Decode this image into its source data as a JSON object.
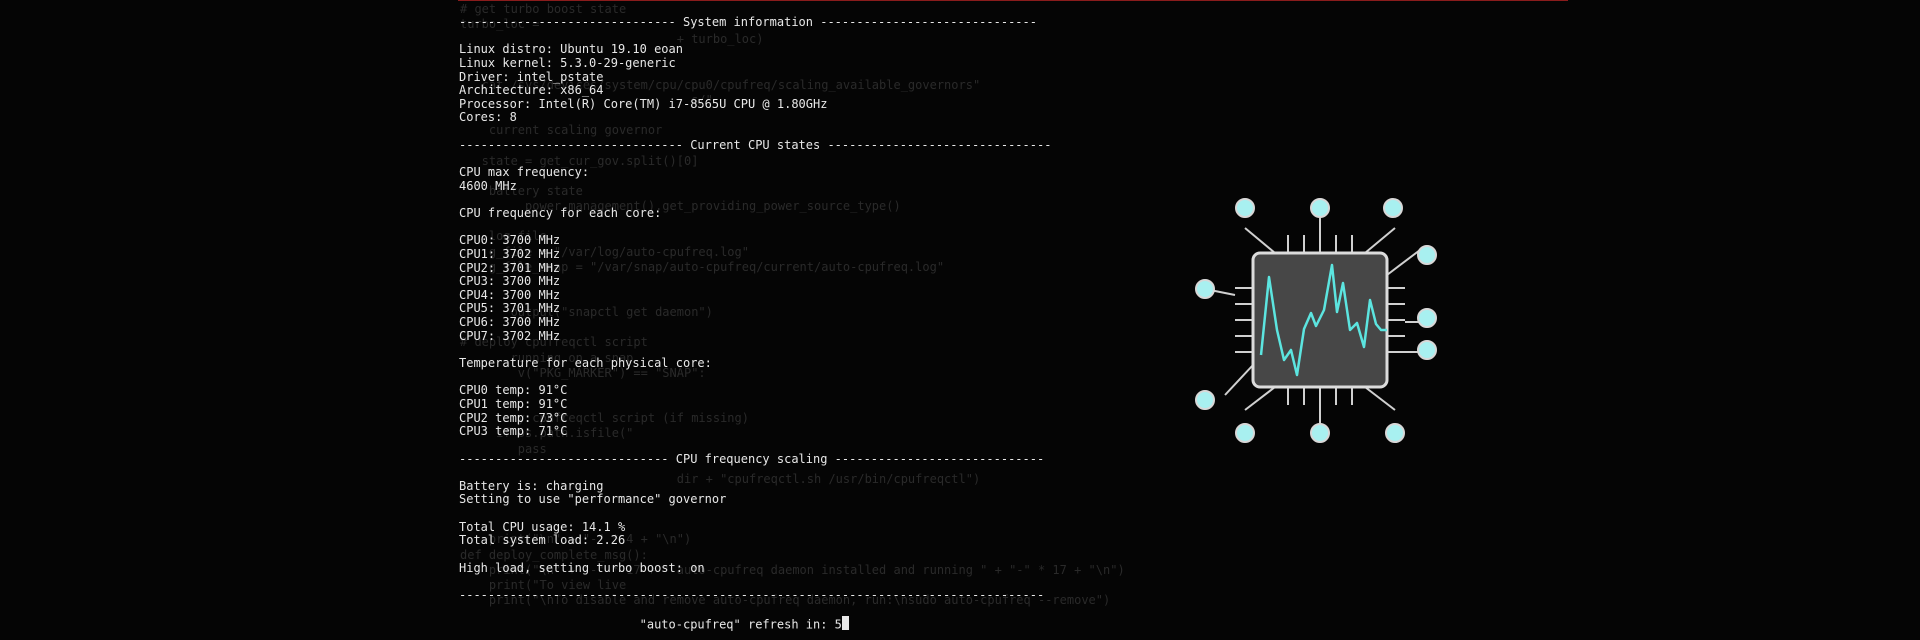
{
  "background_code": [
    "# get turbo boost state",
    "turbo_loc = ",
    "                              + turbo_loc)",
    "",
    "",
    "   cat /sys/devices/system/cpu/cpu0/cpufreq/scaling_available_governors\"",
    "                                s/\"",
    "",
    "    current scaling governor",
    "",
    "   state = get_cur_gov.split()[0]",
    "",
    "    battery state",
    "         power_management().get_providing_power_source_type()",
    "",
    "    log file",
    "    g_file = \"/var/log/auto-cpufreq.log\"",
    "    g_file_snap = \"/var/snap/auto-cpufreq/current/auto-cpufreq.log\"",
    "",
    "",
    "       output(\"snapctl get daemon\")",
    "",
    "# deploy cpufreqctl script",
    "       running on a snap",
    "        v(\"PKG_MARKER\") == \"SNAP\":",
    "",
    "",
    "        y cpufreqctl script (if missing)",
    "     if os.path.isfile(\"",
    "        pass",
    "",
    "                              dir + \"cpufreqctl.sh /usr/bin/cpufreqctl\")",
    "",
    "",
    "",
    "    print(\"\\n\" + \"-\" * 4 + \"\\n\")",
    "def deploy_complete_msg():",
    "    print(\"\\n\" + \"-\" * 17 + \" auto-cpufreq daemon installed and running \" + \"-\" * 17 + \"\\n\")",
    "    print(\"To view live",
    "    print(\"\\nTo disable and remove auto-cpufreq daemon, run:\\nsudo auto-cpufreq --remove\")"
  ],
  "terminal_lines": [
    "------------------------------ System information ------------------------------",
    "",
    "Linux distro: Ubuntu 19.10 eoan",
    "Linux kernel: 5.3.0-29-generic",
    "Driver: intel_pstate",
    "Architecture: x86_64",
    "Processor: Intel(R) Core(TM) i7-8565U CPU @ 1.80GHz",
    "Cores: 8",
    "",
    "------------------------------- Current CPU states -------------------------------",
    "",
    "CPU max frequency:",
    "4600 MHz",
    "",
    "CPU frequency for each core:",
    "",
    "CPU0: 3700 MHz",
    "CPU1: 3702 MHz",
    "CPU2: 3701 MHz",
    "CPU3: 3700 MHz",
    "CPU4: 3700 MHz",
    "CPU5: 3701 MHz",
    "CPU6: 3700 MHz",
    "CPU7: 3702 MHz",
    "",
    "Temperature for each physical core:",
    "",
    "CPU0 temp: 91°C",
    "CPU1 temp: 91°C",
    "CPU2 temp: 73°C",
    "CPU3 temp: 71°C",
    "",
    "----------------------------- CPU frequency scaling -----------------------------",
    "",
    "Battery is: charging",
    "Setting to use \"performance\" governor",
    "",
    "Total CPU usage: 14.1 %",
    "Total system load: 2.26",
    "",
    "High load, setting turbo boost: on",
    "",
    "---------------------------------------------------------------------------------",
    "",
    "                         \"auto-cpufreq\" refresh in: 5"
  ],
  "logo": {
    "icon": "cpu-chip-icon",
    "colors": {
      "node": "#a8f0f0",
      "trace": "#5ce5e0",
      "chip": "#444444",
      "border": "#d8d8d8",
      "line": "#d0d0d0"
    }
  }
}
